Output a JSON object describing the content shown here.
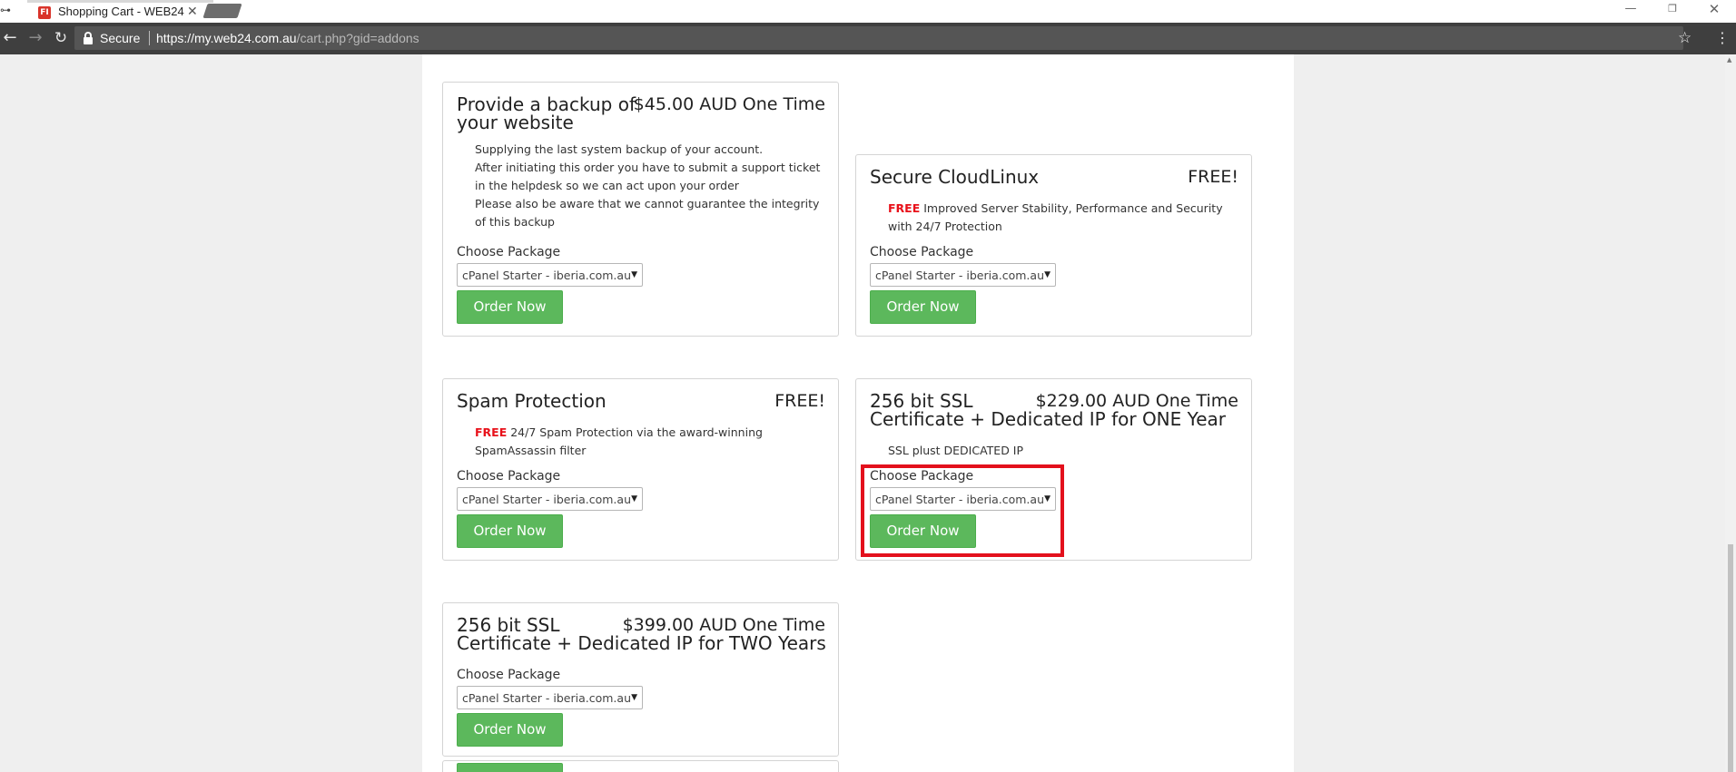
{
  "browser": {
    "tab_title": "Shopping Cart - WEB24",
    "tab_favicon_text": "FI",
    "secure_label": "Secure",
    "url_host": "https://my.web24.com.au",
    "url_path": "/cart.php?gid=addons"
  },
  "addons": [
    {
      "name_line1": "Provide a backup of",
      "name_line2": "your website",
      "price": "$45.00 AUD One Time",
      "description": [
        "Supplying the last system backup of your account.",
        "After initiating this order you have to submit a support ticket",
        "in the helpdesk so we can act upon your order",
        "Please also be aware that we cannot guarantee the integrity",
        "of this backup"
      ],
      "choose_label": "Choose Package",
      "package": "cPanel Starter - iberia.com.au",
      "button": "Order Now"
    },
    {
      "name_line1": "Secure CloudLinux",
      "price": "FREE!",
      "free_tag": "FREE",
      "description": [
        " Improved Server Stability, Performance and Security",
        "with 24/7 Protection"
      ],
      "choose_label": "Choose Package",
      "package": "cPanel Starter - iberia.com.au",
      "button": "Order Now"
    },
    {
      "name_line1": "Spam Protection",
      "price": "FREE!",
      "free_tag": "FREE",
      "description": [
        " 24/7 Spam Protection via the award-winning",
        "SpamAssassin filter"
      ],
      "choose_label": "Choose Package",
      "package": "cPanel Starter - iberia.com.au",
      "button": "Order Now"
    },
    {
      "name_line1": "256 bit SSL",
      "name_line2": "Certificate + Dedicated IP for ONE Year",
      "price": "$229.00 AUD One Time",
      "description": [
        "SSL plust DEDICATED IP"
      ],
      "choose_label": "Choose Package",
      "package": "cPanel Starter - iberia.com.au",
      "button": "Order Now",
      "highlighted": true
    },
    {
      "name_line1": "256 bit SSL",
      "name_line2": "Certificate + Dedicated IP for TWO Years",
      "price": "$399.00 AUD One Time",
      "choose_label": "Choose Package",
      "package": "cPanel Starter - iberia.com.au",
      "button": "Order Now"
    }
  ],
  "colors": {
    "order_button": "#5cb85c",
    "free_tag": "#e8111a",
    "highlight": "#e3101c",
    "toolbar": "#3f3f3f"
  }
}
